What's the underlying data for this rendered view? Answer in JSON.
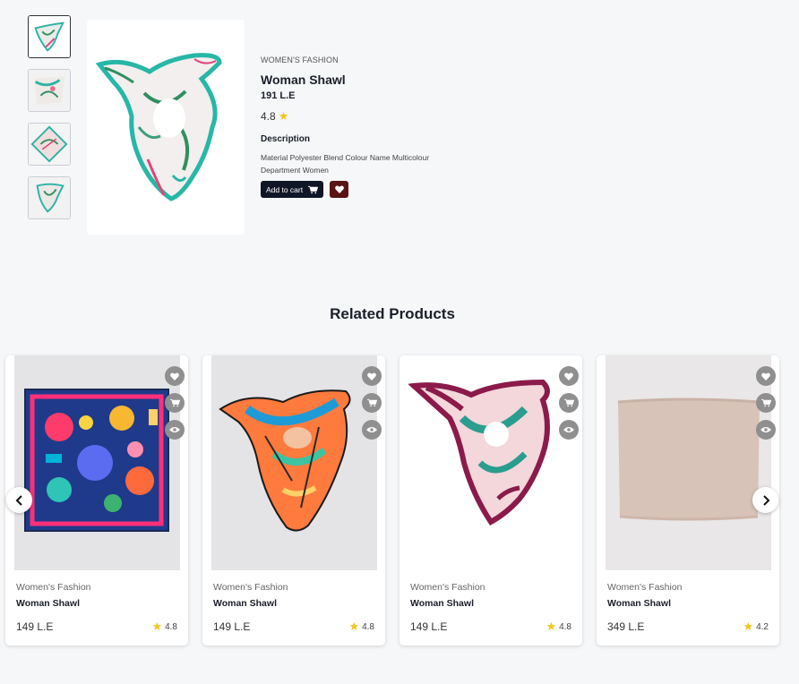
{
  "product": {
    "category": "WOMEN'S FASHION",
    "title": "Woman Shawl",
    "price": "191 L.E",
    "rating": "4.8",
    "description_heading": "Description",
    "description_line1": "Material Polyester Blend Colour Name Multicolour",
    "description_line2": "Department Women",
    "add_to_cart_label": "Add to cart"
  },
  "related": {
    "heading": "Related Products",
    "items": [
      {
        "category": "Women's Fashion",
        "name": "Woman Shawl",
        "price": "149 L.E",
        "rating": "4.8"
      },
      {
        "category": "Women's Fashion",
        "name": "Woman Shawl",
        "price": "149 L.E",
        "rating": "4.8"
      },
      {
        "category": "Women's Fashion",
        "name": "Woman Shawl",
        "price": "149 L.E",
        "rating": "4.8"
      },
      {
        "category": "Women's Fashion",
        "name": "Woman Shawl",
        "price": "349 L.E",
        "rating": "4.2"
      }
    ]
  },
  "colors": {
    "page_background": "#f6f7f9",
    "cart_button": "#0f1626",
    "wishlist_button": "#5a1414",
    "star": "#f5c518",
    "card_icon_bg": "#8f8f8f"
  },
  "icons": [
    "cart-icon",
    "heart-icon",
    "eye-icon",
    "star-icon",
    "chevron-left-icon",
    "chevron-right-icon"
  ]
}
